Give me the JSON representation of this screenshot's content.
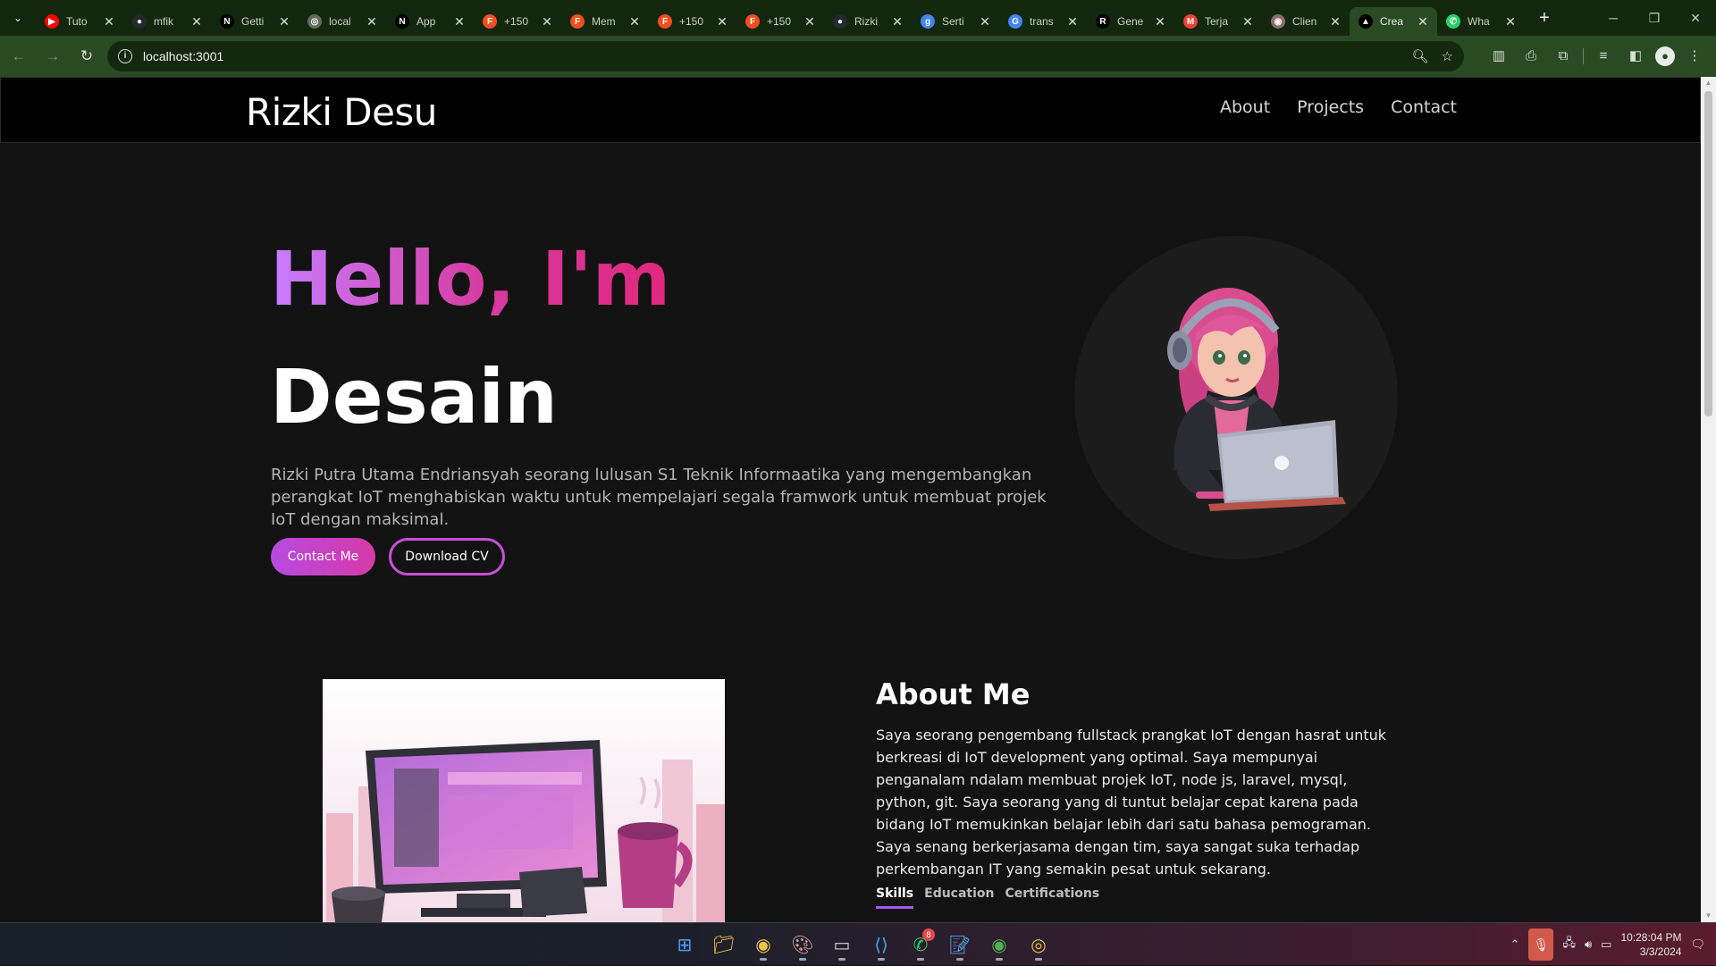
{
  "browser": {
    "tabs": [
      {
        "title": "Tuto",
        "favicon": "youtube-icon",
        "color": "#ff0000",
        "glyph": "▶"
      },
      {
        "title": "mfik",
        "favicon": "github-icon",
        "color": "#24292e",
        "glyph": "●"
      },
      {
        "title": "Getti",
        "favicon": "notion-icon",
        "color": "#000000",
        "glyph": "N"
      },
      {
        "title": "local",
        "favicon": "globe-icon",
        "color": "#5f6b5b",
        "glyph": "◎"
      },
      {
        "title": "App",
        "favicon": "notion-icon",
        "color": "#000000",
        "glyph": "N"
      },
      {
        "title": "+150",
        "favicon": "figma-icon",
        "color": "#f24e1e",
        "glyph": "F"
      },
      {
        "title": "Mem",
        "favicon": "figma-icon",
        "color": "#f24e1e",
        "glyph": "F"
      },
      {
        "title": "+150",
        "favicon": "figma-icon",
        "color": "#f24e1e",
        "glyph": "F"
      },
      {
        "title": "+150",
        "favicon": "figma-icon",
        "color": "#f24e1e",
        "glyph": "F"
      },
      {
        "title": "Rizki",
        "favicon": "github-icon",
        "color": "#24292e",
        "glyph": "●"
      },
      {
        "title": "Serti",
        "favicon": "google-icon",
        "color": "#4285f4",
        "glyph": "g"
      },
      {
        "title": "trans",
        "favicon": "google-icon",
        "color": "#4285f4",
        "glyph": "G"
      },
      {
        "title": "Gene",
        "favicon": "r-icon",
        "color": "#000000",
        "glyph": "R"
      },
      {
        "title": "Terja",
        "favicon": "gmail-icon",
        "color": "#ea4335",
        "glyph": "M"
      },
      {
        "title": "Clien",
        "favicon": "globe-icon",
        "color": "#8a6d6d",
        "glyph": "◉"
      },
      {
        "title": "Crea",
        "favicon": "vercel-icon",
        "color": "#000000",
        "glyph": "▲",
        "active": true
      },
      {
        "title": "Wha",
        "favicon": "whatsapp-icon",
        "color": "#25d366",
        "glyph": "✆"
      }
    ],
    "url": "localhost:3001",
    "accent": "#2a4a24"
  },
  "site": {
    "brand": "Rizki Desu",
    "nav": {
      "about": "About",
      "projects": "Projects",
      "contact": "Contact"
    },
    "hero": {
      "greeting": "Hello, I'm",
      "name": "Desain",
      "intro": "Rizki Putra Utama Endriansyah seorang lulusan S1 Teknik Informaatika yang mengembangkan perangkat IoT menghabiskan waktu untuk mempelajari segala framwork untuk membuat projek IoT dengan maksimal.",
      "contact_button": "Contact Me",
      "cv_button": "Download CV"
    },
    "about": {
      "title": "About Me",
      "text": "Saya seorang pengembang fullstack prangkat IoT dengan hasrat untuk berkreasi di IoT development yang optimal. Saya mempunyai penganalam ndalam membuat projek IoT, node js, laravel, mysql, python, git. Saya seorang yang di tuntut belajar cepat karena pada bidang IoT memukinkan belajar lebih dari satu bahasa pemograman. Saya senang berkerjasama dengan tim, saya sangat suka terhadap perkembangan IT yang semakin pesat untuk sekarang.",
      "tabs": {
        "skills": "Skills",
        "education": "Education",
        "certifications": "Certifications"
      }
    },
    "gradient": {
      "start": "#c77dff",
      "end": "#e0287e"
    }
  },
  "taskbar": {
    "apps": [
      {
        "name": "start-icon"
      },
      {
        "name": "file-explorer-icon"
      },
      {
        "name": "chrome-icon"
      },
      {
        "name": "paint-icon"
      },
      {
        "name": "terminal-icon"
      },
      {
        "name": "vscode-icon"
      },
      {
        "name": "whatsapp-icon",
        "badge": "8"
      },
      {
        "name": "notepad-icon"
      },
      {
        "name": "chrome-green-icon"
      },
      {
        "name": "chrome-alt-icon"
      }
    ],
    "time": "10:28:04 PM",
    "date": "3/3/2024"
  }
}
